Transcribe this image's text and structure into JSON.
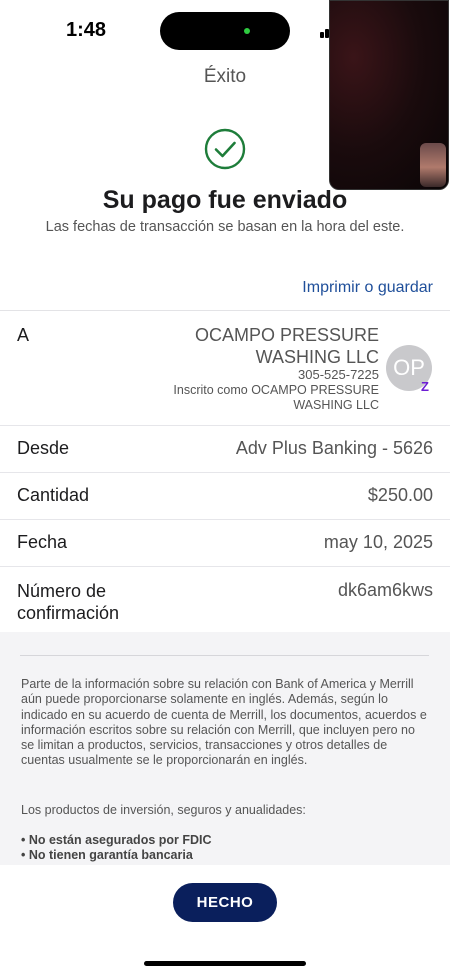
{
  "status_bar": {
    "time": "1:48"
  },
  "header": {
    "title": "Éxito"
  },
  "success": {
    "title": "Su pago fue enviado",
    "note": "Las fechas de transacción se basan en la hora del este."
  },
  "print_link": "Imprimir o guardar",
  "details": {
    "to": {
      "label": "A",
      "name": "OCAMPO PRESSURE WASHING LLC",
      "phone": "305-525-7225",
      "enrolled": "Inscrito como OCAMPO PRESSURE WASHING LLC",
      "avatar_initials": "OP",
      "badge": "Z"
    },
    "from": {
      "label": "Desde",
      "value": "Adv Plus Banking - 5626"
    },
    "amount": {
      "label": "Cantidad",
      "value": "$250.00"
    },
    "date": {
      "label": "Fecha",
      "value": "may 10, 2025"
    },
    "confirmation": {
      "label": "Número de confirmación",
      "value": "dk6am6kws"
    }
  },
  "disclaimer": {
    "text": "Parte de la información sobre su relación con Bank of America y Merrill aún puede proporcionarse solamente en inglés. Además, según lo indicado en su acuerdo de cuenta de Merrill, los documentos, acuerdos e información escritos sobre su relación con Merrill, que incluyen pero no se limitan a productos, servicios, transacciones y otros detalles de cuentas usualmente se le proporcionarán en inglés.",
    "investment_heading": "Los productos de inversión, seguros y anualidades:",
    "investment_items": [
      "• No están asegurados por FDIC",
      "• No tienen garantía bancaria"
    ]
  },
  "done_button": "HECHO",
  "colors": {
    "accent": "#0a1f5c",
    "link": "#1f4f9a",
    "success": "#1e7d3a",
    "zelle": "#6d1ed4"
  }
}
